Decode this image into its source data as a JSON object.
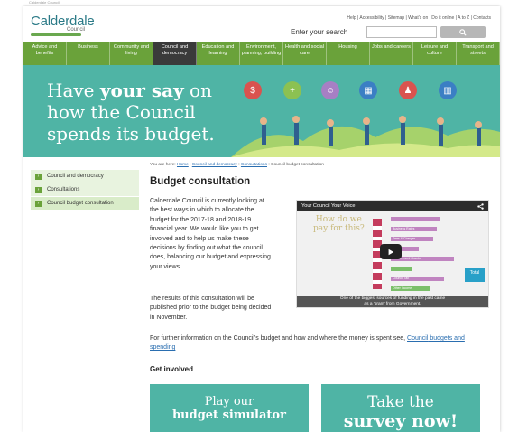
{
  "browser": {
    "tab_note": "Calderdale Council"
  },
  "header": {
    "brand_name": "Calderdale",
    "brand_sub": "Council",
    "utility_links": "Help | Accessibility | Sitemap | What's on | Do it online | A to Z | Contacts",
    "search_placeholder": "Enter your search"
  },
  "nav": [
    "Advice and benefits",
    "Business",
    "Community and living",
    "Council and democracy",
    "Education and learning",
    "Environment, planning, building",
    "Health and social care",
    "Housing",
    "Jobs and careers",
    "Leisure and culture",
    "Transport and streets"
  ],
  "hero": {
    "line1_pre": "Have ",
    "line1_bold": "your say",
    "line1_post": " on",
    "line2": "how the Council",
    "line3": "spends its budget."
  },
  "leftnav": [
    "Council and democracy",
    "Consultations",
    "Council budget consultation"
  ],
  "breadcrumb": {
    "prefix": "You are here:",
    "home": "Home",
    "council": "Council and democracy",
    "consultations": "Consultations",
    "current": "Council budget consultation"
  },
  "main": {
    "title": "Budget consultation",
    "intro_lines": [
      "Calderdale Council is currently looking at",
      "the best ways in which to allocate the",
      "budget for the 2017-18 and 2018-19",
      "financial year. We would like you to get",
      "involved and to help us make these",
      "decisions by finding out what the council",
      "does, balancing our budget and expressing",
      "your views."
    ],
    "results_lines": [
      "The results of this consultation will be",
      "published prior to the budget being decided",
      "in November."
    ],
    "further_text": "For further information on the Council's budget and how and where the money is spent see,",
    "further_link_1": "Council",
    "further_link_2": "budgets and spending",
    "get_involved": "Get involved"
  },
  "video": {
    "title": "Your Council Your Voice",
    "question_1": "How do we",
    "question_2": "pay for this?",
    "bar_labels": [
      "",
      "Business Rates",
      "Fees & Charges",
      "",
      "Government Grants",
      "",
      "Council Tax",
      "Other Income"
    ],
    "total_label": "Total",
    "caption_1": "One of the biggest sources of funding in the past came",
    "caption_2": "as a 'grant' from Government."
  },
  "cta": [
    {
      "line1": "Play our",
      "line2": "budget simulator"
    },
    {
      "line1": "Take the",
      "line2": "survey now!"
    }
  ],
  "colors": {
    "green": "#6aa23a",
    "teal": "#4fb4a5",
    "link": "#2a6eb0"
  }
}
